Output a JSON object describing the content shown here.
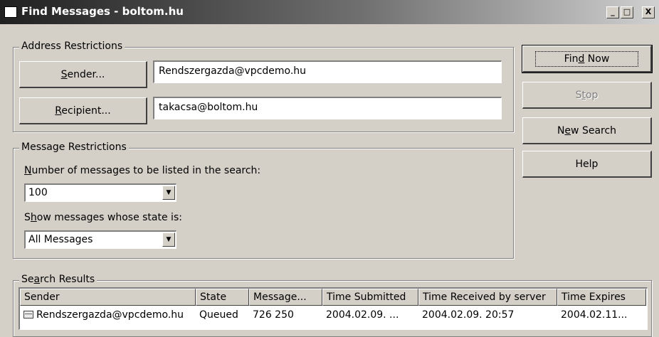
{
  "window": {
    "title": "Find Messages - boltom.hu",
    "minimize_glyph": "_",
    "maximize_glyph": "□",
    "close_glyph": "X"
  },
  "address_restrictions": {
    "group_label": "Address Restrictions",
    "sender_button": {
      "pre": "",
      "accel": "S",
      "post": "ender..."
    },
    "recipient_button": {
      "pre": "",
      "accel": "R",
      "post": "ecipient..."
    },
    "sender_value": "Rendszergazda@vpcdemo.hu",
    "recipient_value": "takacsa@boltom.hu"
  },
  "message_restrictions": {
    "group_label": "Message Restrictions",
    "count_label": {
      "pre": "",
      "accel": "N",
      "post": "umber of messages to be listed in the search:"
    },
    "count_value": "100",
    "state_label": {
      "pre": "S",
      "accel": "h",
      "post": "ow messages whose state is:"
    },
    "state_value": "All Messages"
  },
  "actions": {
    "find_now": {
      "pre": "Fin",
      "accel": "d",
      "post": " Now"
    },
    "stop": {
      "pre": "S",
      "accel": "t",
      "post": "op"
    },
    "new_search": {
      "pre": "N",
      "accel": "e",
      "post": "w Search"
    },
    "help": "Help"
  },
  "search_results": {
    "group_label": {
      "pre": "Se",
      "accel": "a",
      "post": "rch Results"
    },
    "columns": [
      "Sender",
      "State",
      "Message...",
      "Time Submitted",
      "Time Received by server",
      "Time Expires"
    ],
    "rows": [
      [
        "Rendszergazda@vpcdemo.hu",
        "Queued",
        "726 250",
        "2004.02.09. ...",
        "2004.02.09.  20:57",
        "2004.02.11..."
      ]
    ]
  },
  "icons": {
    "dropdown": "dropdown-arrow-icon",
    "message": "mail-message-icon",
    "window": "window-icon"
  }
}
